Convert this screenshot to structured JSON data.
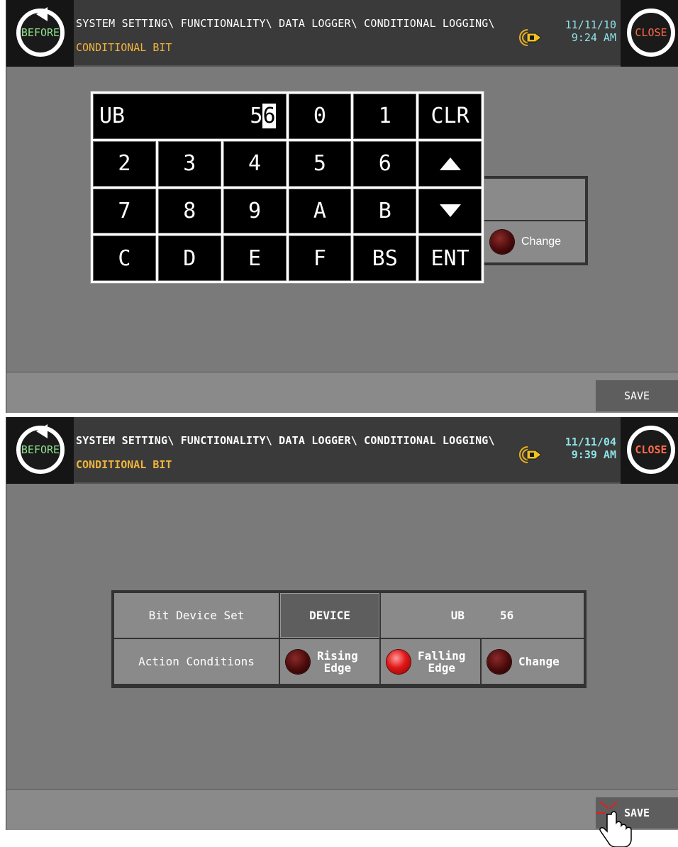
{
  "screen1": {
    "header": {
      "before_label": "BEFORE",
      "close_label": "CLOSE",
      "path_line1": "SYSTEM SETTING\\ FUNCTIONALITY\\ DATA LOGGER\\ CONDITIONAL LOGGING\\",
      "path_line2": "CONDITIONAL BIT",
      "date": "11/11/10",
      "time": "9:24 AM"
    },
    "keypad": {
      "device_prefix": "UB",
      "value_fixed": "5",
      "value_cursor": "6",
      "keys": [
        "0",
        "1",
        "CLR",
        "2",
        "3",
        "4",
        "5",
        "6",
        "7",
        "8",
        "9",
        "A",
        "B",
        "C",
        "D",
        "E",
        "F",
        "BS",
        "ENT"
      ]
    },
    "background_option": "Change",
    "save_label": "SAVE"
  },
  "screen2": {
    "header": {
      "before_label": "BEFORE",
      "close_label": "CLOSE",
      "path_line1": "SYSTEM SETTING\\ FUNCTIONALITY\\ DATA LOGGER\\ CONDITIONAL LOGGING\\",
      "path_line2": "CONDITIONAL BIT",
      "date": "11/11/04",
      "time": "9:39 AM"
    },
    "bit_device_label": "Bit Device Set",
    "device_button": "DEVICE",
    "device_type": "UB",
    "device_number": "56",
    "action_label": "Action Conditions",
    "options": [
      {
        "line1": "Rising",
        "line2": "Edge",
        "state": "off"
      },
      {
        "line1": "Falling",
        "line2": "Edge",
        "state": "on"
      },
      {
        "line1": "Change",
        "line2": "",
        "state": "off"
      }
    ],
    "save_label": "SAVE"
  },
  "colors": {
    "led_on": "#e01818",
    "led_off": "#4a0a0a",
    "path_highlight": "#f0b43c",
    "datetime": "#8ee3e8",
    "before_text": "#8fe08f",
    "close_text": "#ff6a4a"
  }
}
